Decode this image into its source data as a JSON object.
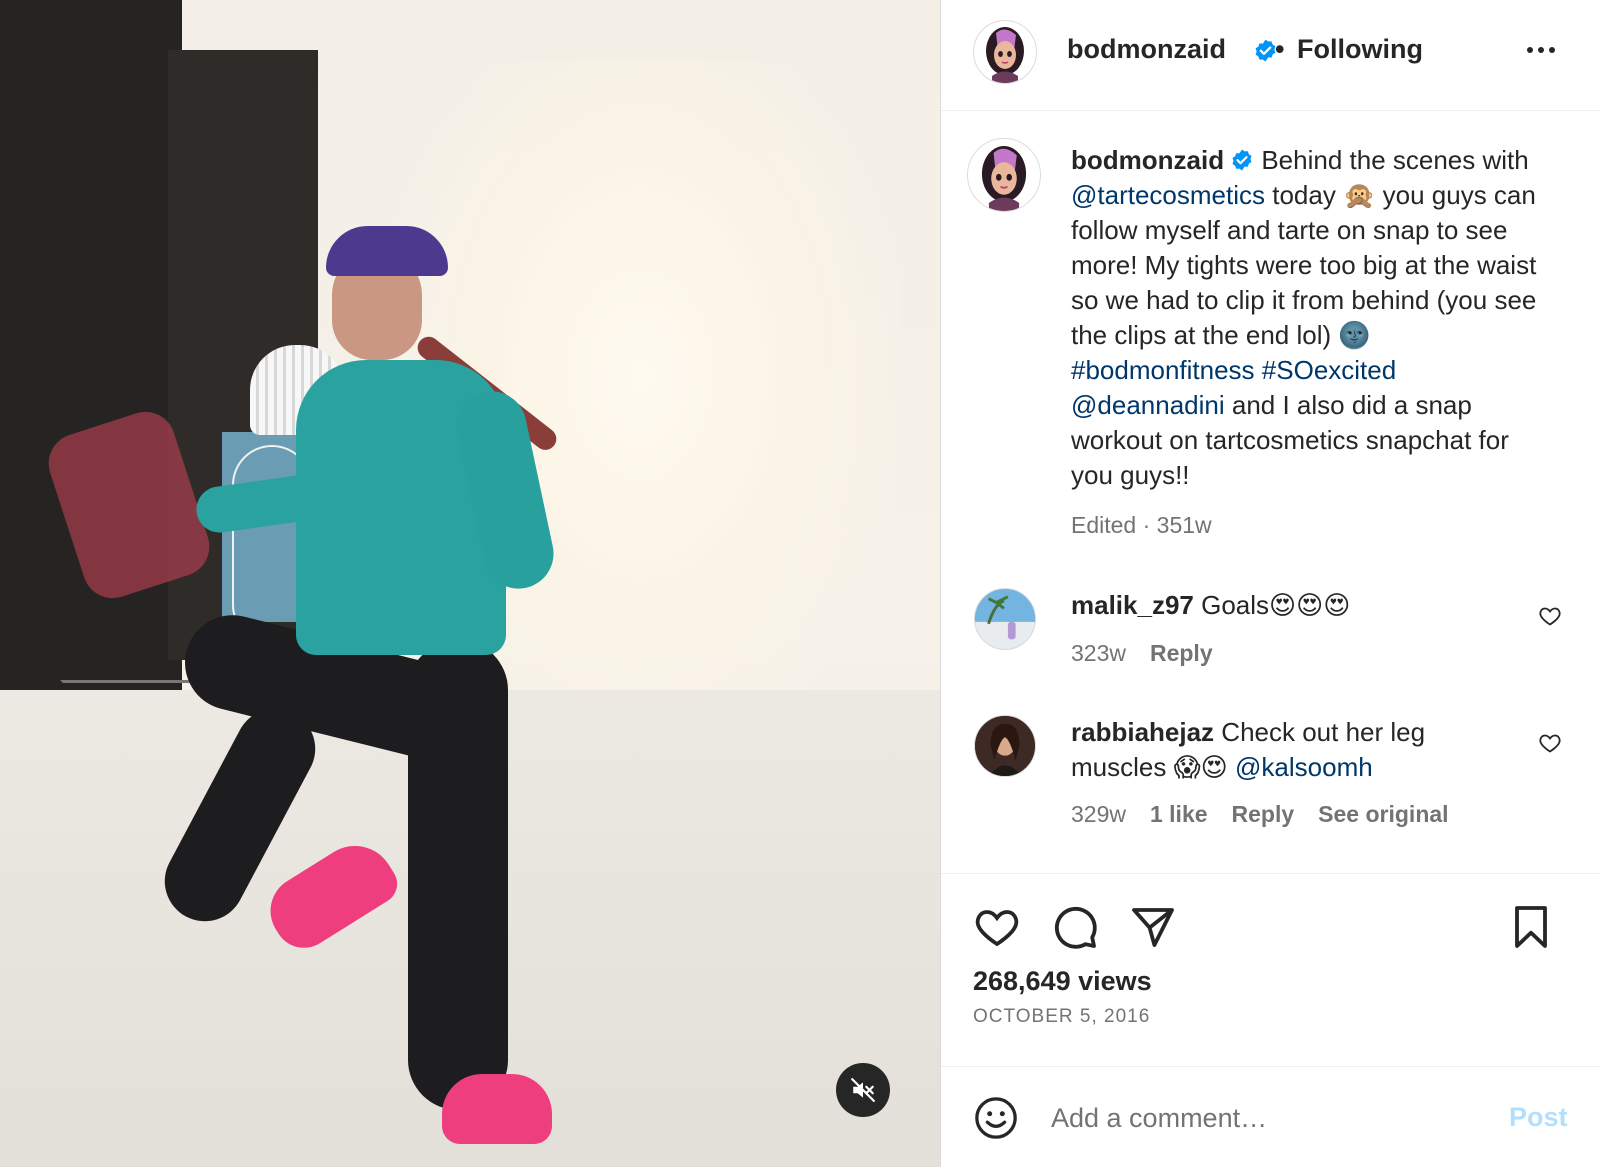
{
  "post": {
    "author": "bodmonzaid",
    "follow_status": "Following",
    "separator": "•",
    "caption_segments": [
      {
        "text": "Behind the scenes with ",
        "type": "text"
      },
      {
        "text": "@tartecosmetics",
        "type": "link"
      },
      {
        "text": " today 🙊 you guys can follow myself and tarte on snap to see more! My tights were too big at the waist so we had to clip it from behind (you see the clips at the end lol) 🌚",
        "type": "text"
      },
      {
        "text": "#bodmonfitness",
        "type": "link"
      },
      {
        "text": " ",
        "type": "text"
      },
      {
        "text": "#SOexcited",
        "type": "link"
      },
      {
        "text": " ",
        "type": "text"
      },
      {
        "text": "@deannadini",
        "type": "link"
      },
      {
        "text": " and I also did a snap workout on tartcosmetics snapchat for you guys!!",
        "type": "text"
      }
    ],
    "caption_meta": "Edited · 351w",
    "views": "268,649 views",
    "date": "OCTOBER 5, 2016"
  },
  "comments": [
    {
      "username": "malik_z97",
      "text": "Goals😍😍😍",
      "mention": "",
      "age": "323w",
      "likes": "",
      "reply": "Reply",
      "see_original": ""
    },
    {
      "username": "rabbiahejaz",
      "text": "Check out her leg muscles 😱😍 ",
      "mention": "@kalsoomh",
      "age": "329w",
      "likes": "1 like",
      "reply": "Reply",
      "see_original": "See original"
    }
  ],
  "composer": {
    "placeholder": "Add a comment…",
    "post_label": "Post"
  },
  "icons": {
    "verified": "verified-badge-icon",
    "more": "more-options-icon",
    "like": "heart-icon",
    "comment": "comment-bubble-icon",
    "share": "paper-plane-icon",
    "save": "bookmark-icon",
    "emoji": "emoji-smiley-icon",
    "mute": "speaker-muted-icon"
  },
  "colors": {
    "link": "#00376b",
    "verified": "#0095f6",
    "post_disabled": "#b2dffc",
    "muted_text": "#737373"
  }
}
